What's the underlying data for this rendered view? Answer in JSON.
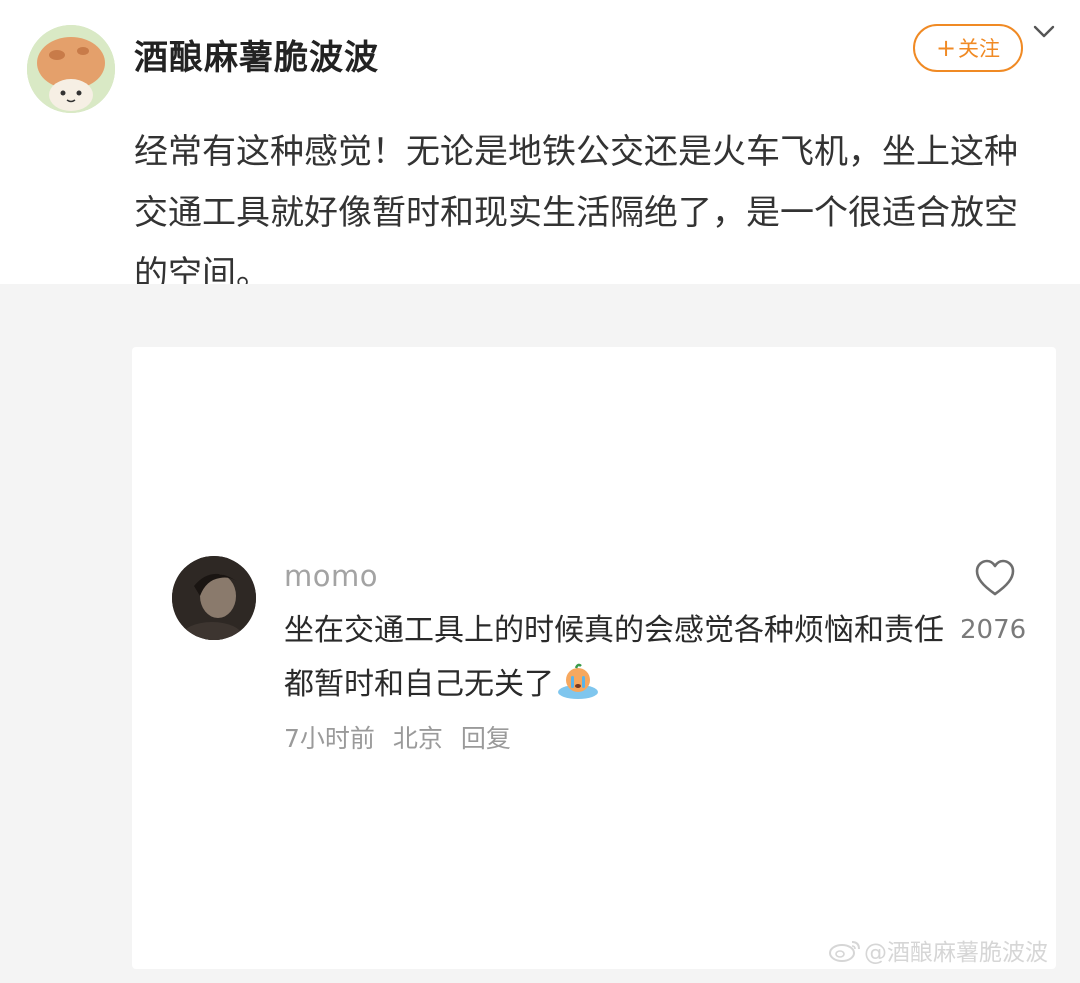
{
  "post": {
    "username": "酒酿麻薯脆波波",
    "follow_label": "关注",
    "follow_plus": "+",
    "text": "经常有这种感觉！无论是地铁公交还是火车飞机，坐上这种交通工具就好像暂时和现实生活隔绝了，是一个很适合放空的空间。"
  },
  "embedded_comment": {
    "username": "momo",
    "text": "坐在交通工具上的时候真的会感觉各种烦恼和责任都暂时和自己无关了",
    "time": "7小时前",
    "location": "北京",
    "reply_label": "回复",
    "likes": "2076",
    "watermark": "@酒酿麻薯脆波波"
  },
  "colors": {
    "accent": "#f08a24",
    "background_gray": "#f4f4f4",
    "muted_text": "#9a9a9a"
  },
  "icons": {
    "more": "chevron-down-icon",
    "like": "heart-icon",
    "emoji": "crying-emoji-icon",
    "watermark": "weibo-logo-icon"
  }
}
